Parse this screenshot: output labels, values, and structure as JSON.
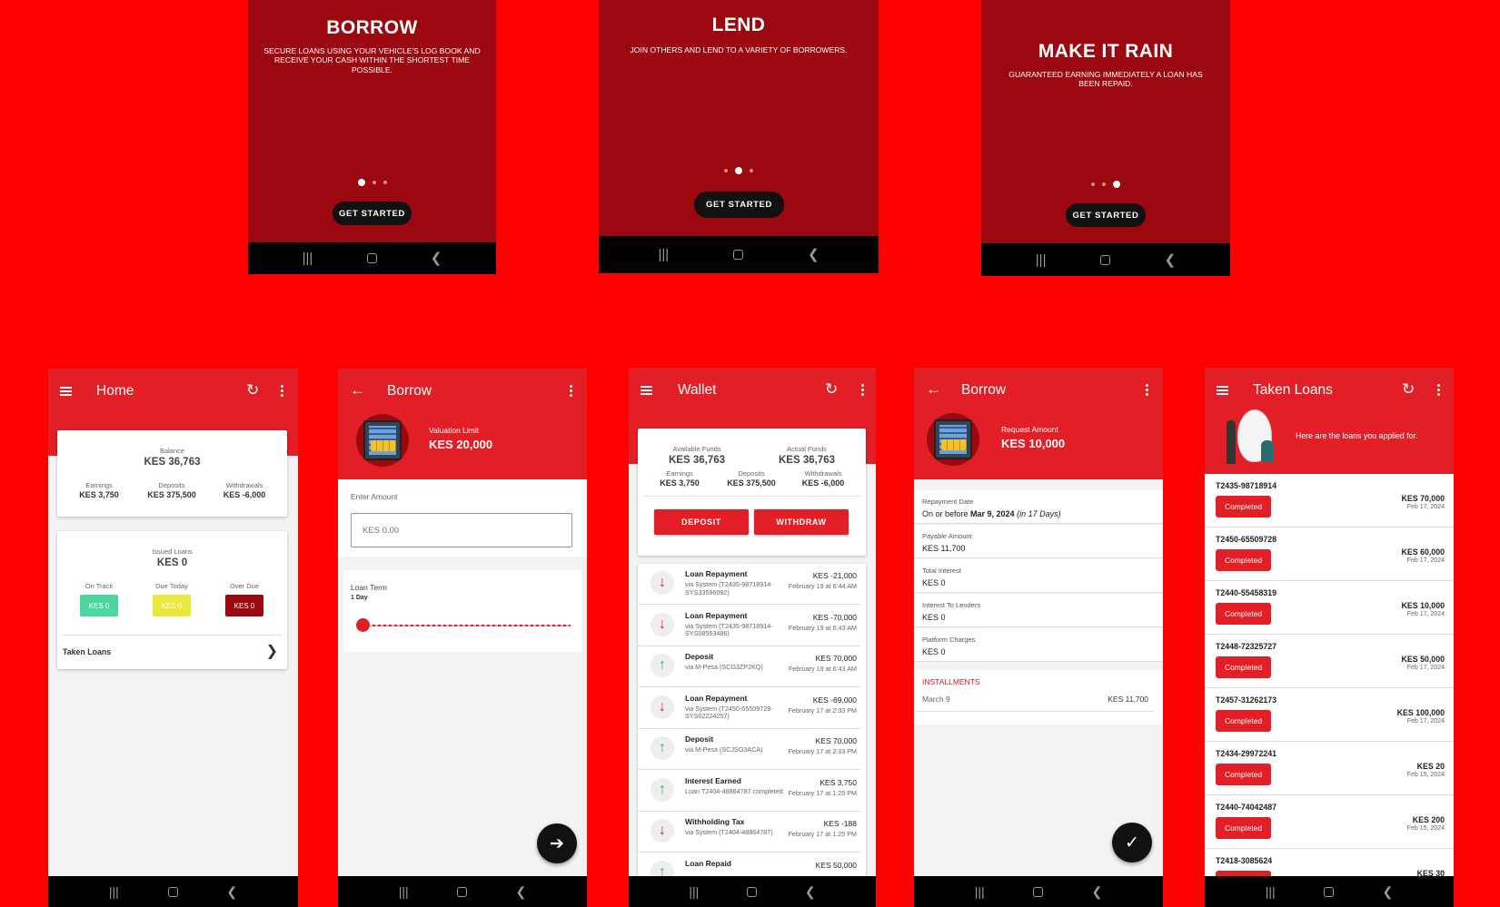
{
  "colors": {
    "brand_red": "#e21e26",
    "dark_red": "#9b0810",
    "background": "#ff0000",
    "on_track": "#4cd6a0",
    "due_today": "#e8e83c",
    "over_due": "#9b0810"
  },
  "onboarding": [
    {
      "title": "BORROW",
      "subtitle": "SECURE LOANS USING YOUR VEHICLE'S LOG BOOK AND RECEIVE YOUR CASH WITHIN THE SHORTEST TIME POSSIBLE.",
      "active_dot": 1,
      "button": "GET STARTED"
    },
    {
      "title": "LEND",
      "subtitle": "JOIN OTHERS AND LEND TO A VARIETY OF BORROWERS.",
      "active_dot": 2,
      "button": "GET STARTED"
    },
    {
      "title": "MAKE IT RAIN",
      "subtitle": "GUARANTEED EARNING IMMEDIATELY A LOAN HAS BEEN REPAID.",
      "active_dot": 3,
      "button": "GET STARTED"
    }
  ],
  "system_nav_icons": [
    "recent-apps-icon",
    "home-icon",
    "back-icon"
  ],
  "home": {
    "title": "Home",
    "balance_label": "Balance",
    "balance": "KES 36,763",
    "earnings_label": "Earnings",
    "earnings": "KES 3,750",
    "deposits_label": "Deposits",
    "deposits": "KES 375,500",
    "withdrawals_label": "Withdrawals",
    "withdrawals": "KES -6,000",
    "issued_label": "Issued Loans",
    "issued": "KES 0",
    "on_track_label": "On Track",
    "on_track": "KES 0",
    "due_today_label": "Due Today",
    "due_today": "KES 0",
    "over_due_label": "Over Due",
    "over_due": "KES 0",
    "taken_loans_link": "Taken Loans"
  },
  "borrow": {
    "title": "Borrow",
    "valuation_label": "Valuation Limit",
    "valuation": "KES 20,000",
    "amount_label": "Enter Amount",
    "amount_placeholder": "KES 0.00",
    "term_label": "Loan Term",
    "term_value": "1 Day"
  },
  "wallet": {
    "title": "Wallet",
    "available_label": "Available Funds",
    "available": "KES 36,763",
    "actual_label": "Actual Funds",
    "actual": "KES 36,763",
    "earnings_label": "Earnings",
    "earnings": "KES 3,750",
    "deposits_label": "Deposits",
    "deposits": "KES 375,500",
    "withdrawals_label": "Withdrawals",
    "withdrawals": "KES -6,000",
    "deposit_button": "DEPOSIT",
    "withdraw_button": "WITHDRAW",
    "transactions": [
      {
        "title": "Loan Repayment",
        "sub": "via System (T2435-98718914-SYS33596092)",
        "amount": "KES -21,000",
        "date": "February 19 at 6:44 AM",
        "dir": "down"
      },
      {
        "title": "Loan Repayment",
        "sub": "via System (T2435-98718914-SYS08563486)",
        "amount": "KES -70,000",
        "date": "February 19 at 6:43 AM",
        "dir": "down"
      },
      {
        "title": "Deposit",
        "sub": "via M-Pesa (SCG3ZP2KQ)",
        "amount": "KES 70,000",
        "date": "February 19 at 6:43 AM",
        "dir": "up"
      },
      {
        "title": "Loan Repayment",
        "sub": "via System (T2450-65509728-SYS02224257)",
        "amount": "KES -69,000",
        "date": "February 17 at 2:33 PM",
        "dir": "down"
      },
      {
        "title": "Deposit",
        "sub": "via M-Pesa (SCJSG3ACA)",
        "amount": "KES 70,000",
        "date": "February 17 at 2:33 PM",
        "dir": "up"
      },
      {
        "title": "Interest Earned",
        "sub": "Loan T2404-48864787 completed",
        "amount": "KES 3,750",
        "date": "February 17 at 1:25 PM",
        "dir": "up"
      },
      {
        "title": "Withholding Tax",
        "sub": "via System (T2404-48864787)",
        "amount": "KES -188",
        "date": "February 17 at 1:25 PM",
        "dir": "down"
      },
      {
        "title": "Loan Repaid",
        "sub": "",
        "amount": "KES 50,000",
        "date": "",
        "dir": "up"
      }
    ]
  },
  "borrow_confirm": {
    "title": "Borrow",
    "request_label": "Request Amount",
    "request": "KES 10,000",
    "repayment_label": "Repayment Date",
    "repayment_prefix": "On or before ",
    "repayment_date": "Mar 9, 2024",
    "repayment_days": "(in 17 Days)",
    "payable_label": "Payable Amount",
    "payable": "KES 11,700",
    "interest_label": "Total Interest",
    "interest": "KES 0",
    "lenders_label": "Interest To Lenders",
    "lenders": "KES 0",
    "platform_label": "Platform Charges",
    "platform": "KES 0",
    "installments_label": "INSTALLMENTS",
    "inst_date": "March 9",
    "inst_amount": "KES 11,700"
  },
  "taken_loans": {
    "title": "Taken Loans",
    "banner_text": "Here are the loans you applied for.",
    "loans": [
      {
        "id": "T2435-98718914",
        "status": "Completed",
        "amount": "KES 70,000",
        "date": "Feb 17, 2024"
      },
      {
        "id": "T2450-65509728",
        "status": "Completed",
        "amount": "KES 60,000",
        "date": "Feb 17, 2024"
      },
      {
        "id": "T2440-55458319",
        "status": "Completed",
        "amount": "KES 10,000",
        "date": "Feb 17, 2024"
      },
      {
        "id": "T2448-72325727",
        "status": "Completed",
        "amount": "KES 50,000",
        "date": "Feb 17, 2024"
      },
      {
        "id": "T2457-31262173",
        "status": "Completed",
        "amount": "KES 100,000",
        "date": "Feb 17, 2024"
      },
      {
        "id": "T2434-29972241",
        "status": "Completed",
        "amount": "KES 20",
        "date": "Feb 15, 2024"
      },
      {
        "id": "T2440-74042487",
        "status": "Completed",
        "amount": "KES 200",
        "date": "Feb 15, 2024"
      },
      {
        "id": "T2418-3085624",
        "status": "",
        "amount": "KES 30",
        "date": ""
      }
    ]
  }
}
